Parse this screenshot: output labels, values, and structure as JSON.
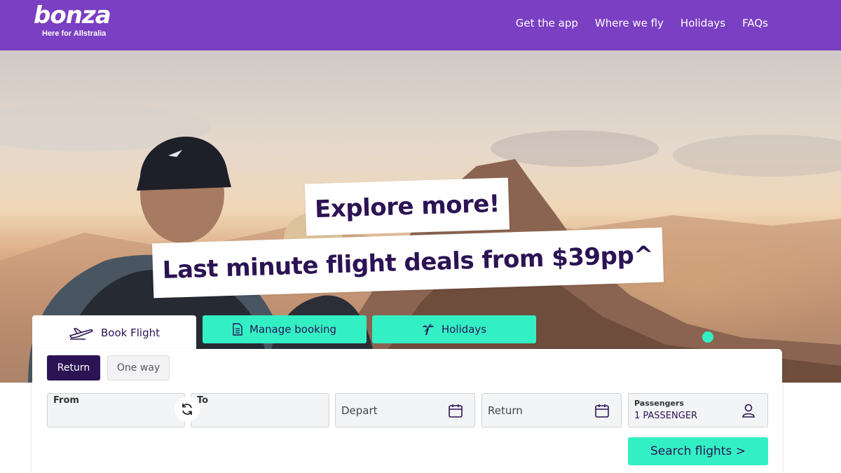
{
  "header": {
    "logo_text": "bonza",
    "logo_tagline": "Here for Allstralia",
    "nav": [
      "Get the app",
      "Where we fly",
      "Holidays",
      "FAQs"
    ]
  },
  "hero": {
    "headline": "Explore more!",
    "subheadline": "Last minute flight deals from $39pp^"
  },
  "tabs": {
    "book": "Book Flight",
    "manage": "Manage booking",
    "holidays": "Holidays"
  },
  "booking": {
    "trip_types": [
      "Return",
      "One way"
    ],
    "selected_trip_type": "Return",
    "from_label": "From",
    "to_label": "To",
    "depart_label": "Depart",
    "return_label": "Return",
    "passengers_label": "Passengers",
    "passengers_value": "1 PASSENGER",
    "search_button": "Search flights >"
  },
  "colors": {
    "brand_purple": "#7a3fc2",
    "dark_purple": "#2c1354",
    "accent_mint": "#33f0c4"
  },
  "icons": [
    "plane-icon",
    "document-icon",
    "palm-tree-icon",
    "swap-icon",
    "calendar-icon",
    "user-icon"
  ]
}
